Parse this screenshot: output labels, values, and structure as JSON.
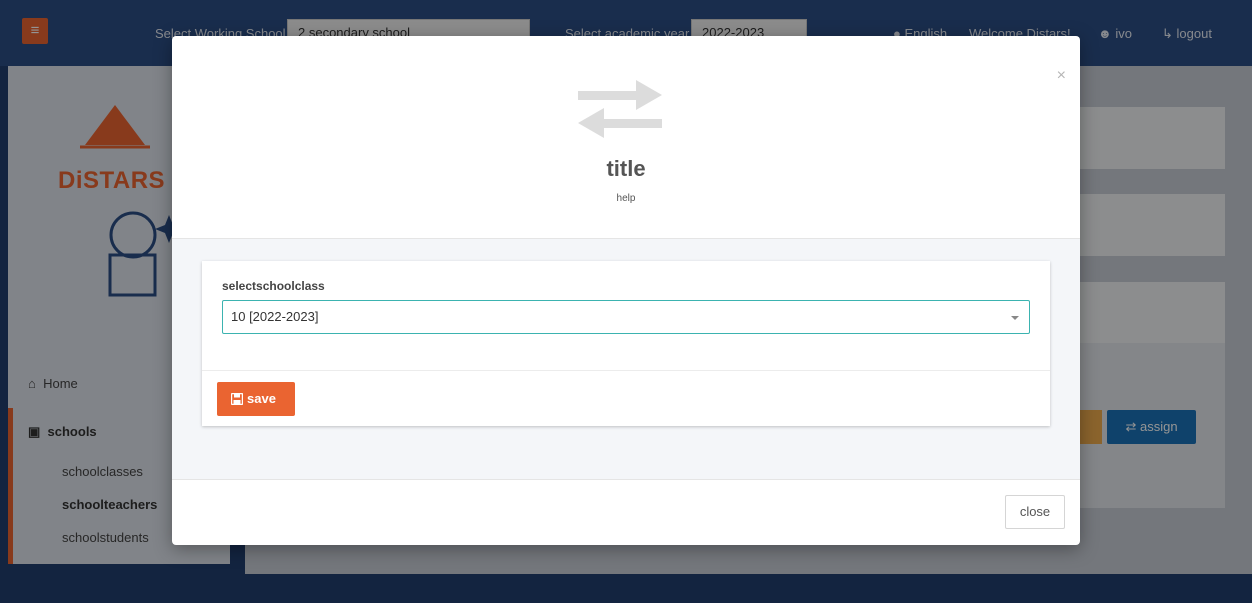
{
  "topbar": {
    "menu_icon": "hamburger-icon",
    "working_school_label": "Select Working School",
    "working_school_value": "2 secondary school",
    "academic_year_label": "Select academic year",
    "academic_year_value": "2022-2023",
    "language_icon": "globe-icon",
    "language": "English",
    "welcome": "Welcome Distars!",
    "user_icon": "user-icon",
    "user": "ivo",
    "logout_icon": "sign-out-icon",
    "logout": "logout"
  },
  "sidebar": {
    "logo_text": "DiSTARS",
    "home_label": "Home",
    "schools_label": "schools",
    "sub_items": [
      "schoolclasses",
      "schoolteachers",
      "schoolstudents"
    ]
  },
  "content": {
    "assign_label": "assign"
  },
  "modal": {
    "icon": "exchange-icon",
    "title": "title",
    "help": "help",
    "field_label": "selectschoolclass",
    "field_value": "10 [2022-2023]",
    "save_label": "save",
    "close_label": "close",
    "close_x": "×"
  },
  "colors": {
    "accent_orange": "#ea6431",
    "header_blue": "#2c4e85",
    "focus_teal": "#3bb3b0",
    "assign_blue": "#1a73b8"
  }
}
